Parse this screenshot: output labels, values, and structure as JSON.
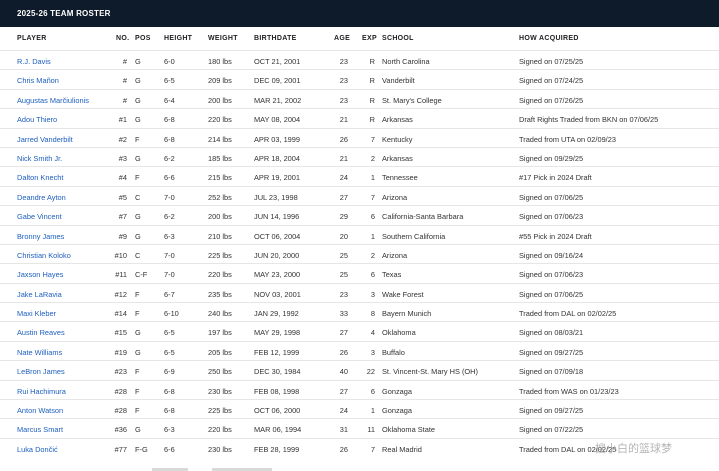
{
  "title": "2025-26 TEAM ROSTER",
  "columns": {
    "player": "PLAYER",
    "no": "NO.",
    "pos": "POS",
    "height": "HEIGHT",
    "weight": "WEIGHT",
    "birthdate": "BIRTHDATE",
    "age": "AGE",
    "exp": "EXP",
    "school": "SCHOOL",
    "how": "HOW ACQUIRED"
  },
  "rows": [
    {
      "player": "R.J. Davis",
      "no": "#",
      "pos": "G",
      "height": "6-0",
      "weight": "180 lbs",
      "birthdate": "OCT 21, 2001",
      "age": "23",
      "exp": "R",
      "school": "North Carolina",
      "how": "Signed on 07/25/25"
    },
    {
      "player": "Chris Mañon",
      "no": "#",
      "pos": "G",
      "height": "6-5",
      "weight": "209 lbs",
      "birthdate": "DEC 09, 2001",
      "age": "23",
      "exp": "R",
      "school": "Vanderbilt",
      "how": "Signed on 07/24/25"
    },
    {
      "player": "Augustas Marčiulionis",
      "no": "#",
      "pos": "G",
      "height": "6-4",
      "weight": "200 lbs",
      "birthdate": "MAR 21, 2002",
      "age": "23",
      "exp": "R",
      "school": "St. Mary's College",
      "how": "Signed on 07/26/25"
    },
    {
      "player": "Adou Thiero",
      "no": "#1",
      "pos": "G",
      "height": "6-8",
      "weight": "220 lbs",
      "birthdate": "MAY 08, 2004",
      "age": "21",
      "exp": "R",
      "school": "Arkansas",
      "how": "Draft Rights Traded from BKN on 07/06/25"
    },
    {
      "player": "Jarred Vanderbilt",
      "no": "#2",
      "pos": "F",
      "height": "6-8",
      "weight": "214 lbs",
      "birthdate": "APR 03, 1999",
      "age": "26",
      "exp": "7",
      "school": "Kentucky",
      "how": "Traded from UTA on 02/09/23"
    },
    {
      "player": "Nick Smith Jr.",
      "no": "#3",
      "pos": "G",
      "height": "6-2",
      "weight": "185 lbs",
      "birthdate": "APR 18, 2004",
      "age": "21",
      "exp": "2",
      "school": "Arkansas",
      "how": "Signed on 09/29/25"
    },
    {
      "player": "Dalton Knecht",
      "no": "#4",
      "pos": "F",
      "height": "6-6",
      "weight": "215 lbs",
      "birthdate": "APR 19, 2001",
      "age": "24",
      "exp": "1",
      "school": "Tennessee",
      "how": "#17 Pick in 2024 Draft"
    },
    {
      "player": "Deandre Ayton",
      "no": "#5",
      "pos": "C",
      "height": "7-0",
      "weight": "252 lbs",
      "birthdate": "JUL 23, 1998",
      "age": "27",
      "exp": "7",
      "school": "Arizona",
      "how": "Signed on 07/06/25"
    },
    {
      "player": "Gabe Vincent",
      "no": "#7",
      "pos": "G",
      "height": "6-2",
      "weight": "200 lbs",
      "birthdate": "JUN 14, 1996",
      "age": "29",
      "exp": "6",
      "school": "California-Santa Barbara",
      "how": "Signed on 07/06/23"
    },
    {
      "player": "Bronny James",
      "no": "#9",
      "pos": "G",
      "height": "6-3",
      "weight": "210 lbs",
      "birthdate": "OCT 06, 2004",
      "age": "20",
      "exp": "1",
      "school": "Southern California",
      "how": "#55 Pick in 2024 Draft"
    },
    {
      "player": "Christian Koloko",
      "no": "#10",
      "pos": "C",
      "height": "7-0",
      "weight": "225 lbs",
      "birthdate": "JUN 20, 2000",
      "age": "25",
      "exp": "2",
      "school": "Arizona",
      "how": "Signed on 09/16/24"
    },
    {
      "player": "Jaxson Hayes",
      "no": "#11",
      "pos": "C-F",
      "height": "7-0",
      "weight": "220 lbs",
      "birthdate": "MAY 23, 2000",
      "age": "25",
      "exp": "6",
      "school": "Texas",
      "how": "Signed on 07/06/23"
    },
    {
      "player": "Jake LaRavia",
      "no": "#12",
      "pos": "F",
      "height": "6-7",
      "weight": "235 lbs",
      "birthdate": "NOV 03, 2001",
      "age": "23",
      "exp": "3",
      "school": "Wake Forest",
      "how": "Signed on 07/06/25"
    },
    {
      "player": "Maxi Kleber",
      "no": "#14",
      "pos": "F",
      "height": "6-10",
      "weight": "240 lbs",
      "birthdate": "JAN 29, 1992",
      "age": "33",
      "exp": "8",
      "school": "Bayern Munich",
      "how": "Traded from DAL on 02/02/25"
    },
    {
      "player": "Austin Reaves",
      "no": "#15",
      "pos": "G",
      "height": "6-5",
      "weight": "197 lbs",
      "birthdate": "MAY 29, 1998",
      "age": "27",
      "exp": "4",
      "school": "Oklahoma",
      "how": "Signed on 08/03/21"
    },
    {
      "player": "Nate Williams",
      "no": "#19",
      "pos": "G",
      "height": "6-5",
      "weight": "205 lbs",
      "birthdate": "FEB 12, 1999",
      "age": "26",
      "exp": "3",
      "school": "Buffalo",
      "how": "Signed on 09/27/25"
    },
    {
      "player": "LeBron James",
      "no": "#23",
      "pos": "F",
      "height": "6-9",
      "weight": "250 lbs",
      "birthdate": "DEC 30, 1984",
      "age": "40",
      "exp": "22",
      "school": "St. Vincent-St. Mary HS (OH)",
      "how": "Signed on 07/09/18"
    },
    {
      "player": "Rui Hachimura",
      "no": "#28",
      "pos": "F",
      "height": "6-8",
      "weight": "230 lbs",
      "birthdate": "FEB 08, 1998",
      "age": "27",
      "exp": "6",
      "school": "Gonzaga",
      "how": "Traded from WAS on 01/23/23"
    },
    {
      "player": "Anton Watson",
      "no": "#28",
      "pos": "F",
      "height": "6-8",
      "weight": "225 lbs",
      "birthdate": "OCT 06, 2000",
      "age": "24",
      "exp": "1",
      "school": "Gonzaga",
      "how": "Signed on 09/27/25"
    },
    {
      "player": "Marcus Smart",
      "no": "#36",
      "pos": "G",
      "height": "6-3",
      "weight": "220 lbs",
      "birthdate": "MAR 06, 1994",
      "age": "31",
      "exp": "11",
      "school": "Oklahoma State",
      "how": "Signed on 07/22/25"
    },
    {
      "player": "Luka Dončić",
      "no": "#77",
      "pos": "F-G",
      "height": "6-6",
      "weight": "230 lbs",
      "birthdate": "FEB 28, 1999",
      "age": "26",
      "exp": "7",
      "school": "Real Madrid",
      "how": "Traded from DAL on 02/02/25"
    }
  ],
  "watermark": "搜小白的篮球梦"
}
